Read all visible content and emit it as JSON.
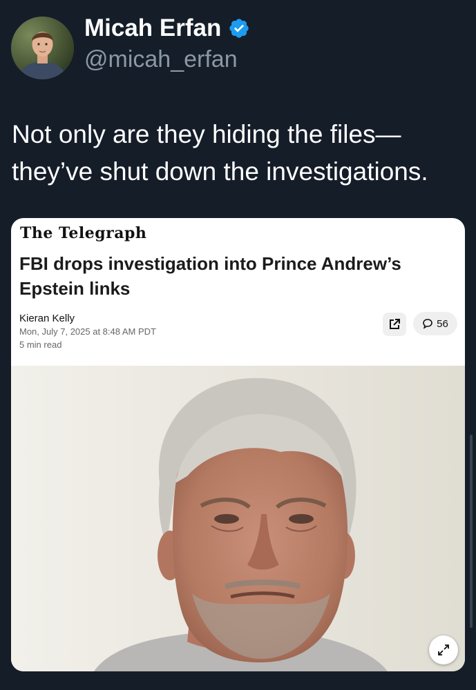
{
  "author": {
    "display_name": "Micah Erfan",
    "handle": "@micah_erfan",
    "verified": true
  },
  "post": {
    "text_lines": [
      "Not only are they hiding the files—",
      "they’ve shut down the investigations."
    ]
  },
  "card": {
    "publication": "The Telegraph",
    "headline": "FBI drops investigation into Prince Andrew’s Epstein links",
    "byline": "Kieran Kelly",
    "date": "Mon, July 7, 2025 at 8:48 AM PDT",
    "read_time": "5 min read",
    "comment_count": "56",
    "icons": {
      "share": "external-link-icon",
      "comment": "speech-bubble-icon",
      "expand": "expand-icon"
    }
  },
  "colors": {
    "background": "#151d29",
    "verified_badge": "#1d9bf0",
    "handle": "#8b98a5"
  }
}
